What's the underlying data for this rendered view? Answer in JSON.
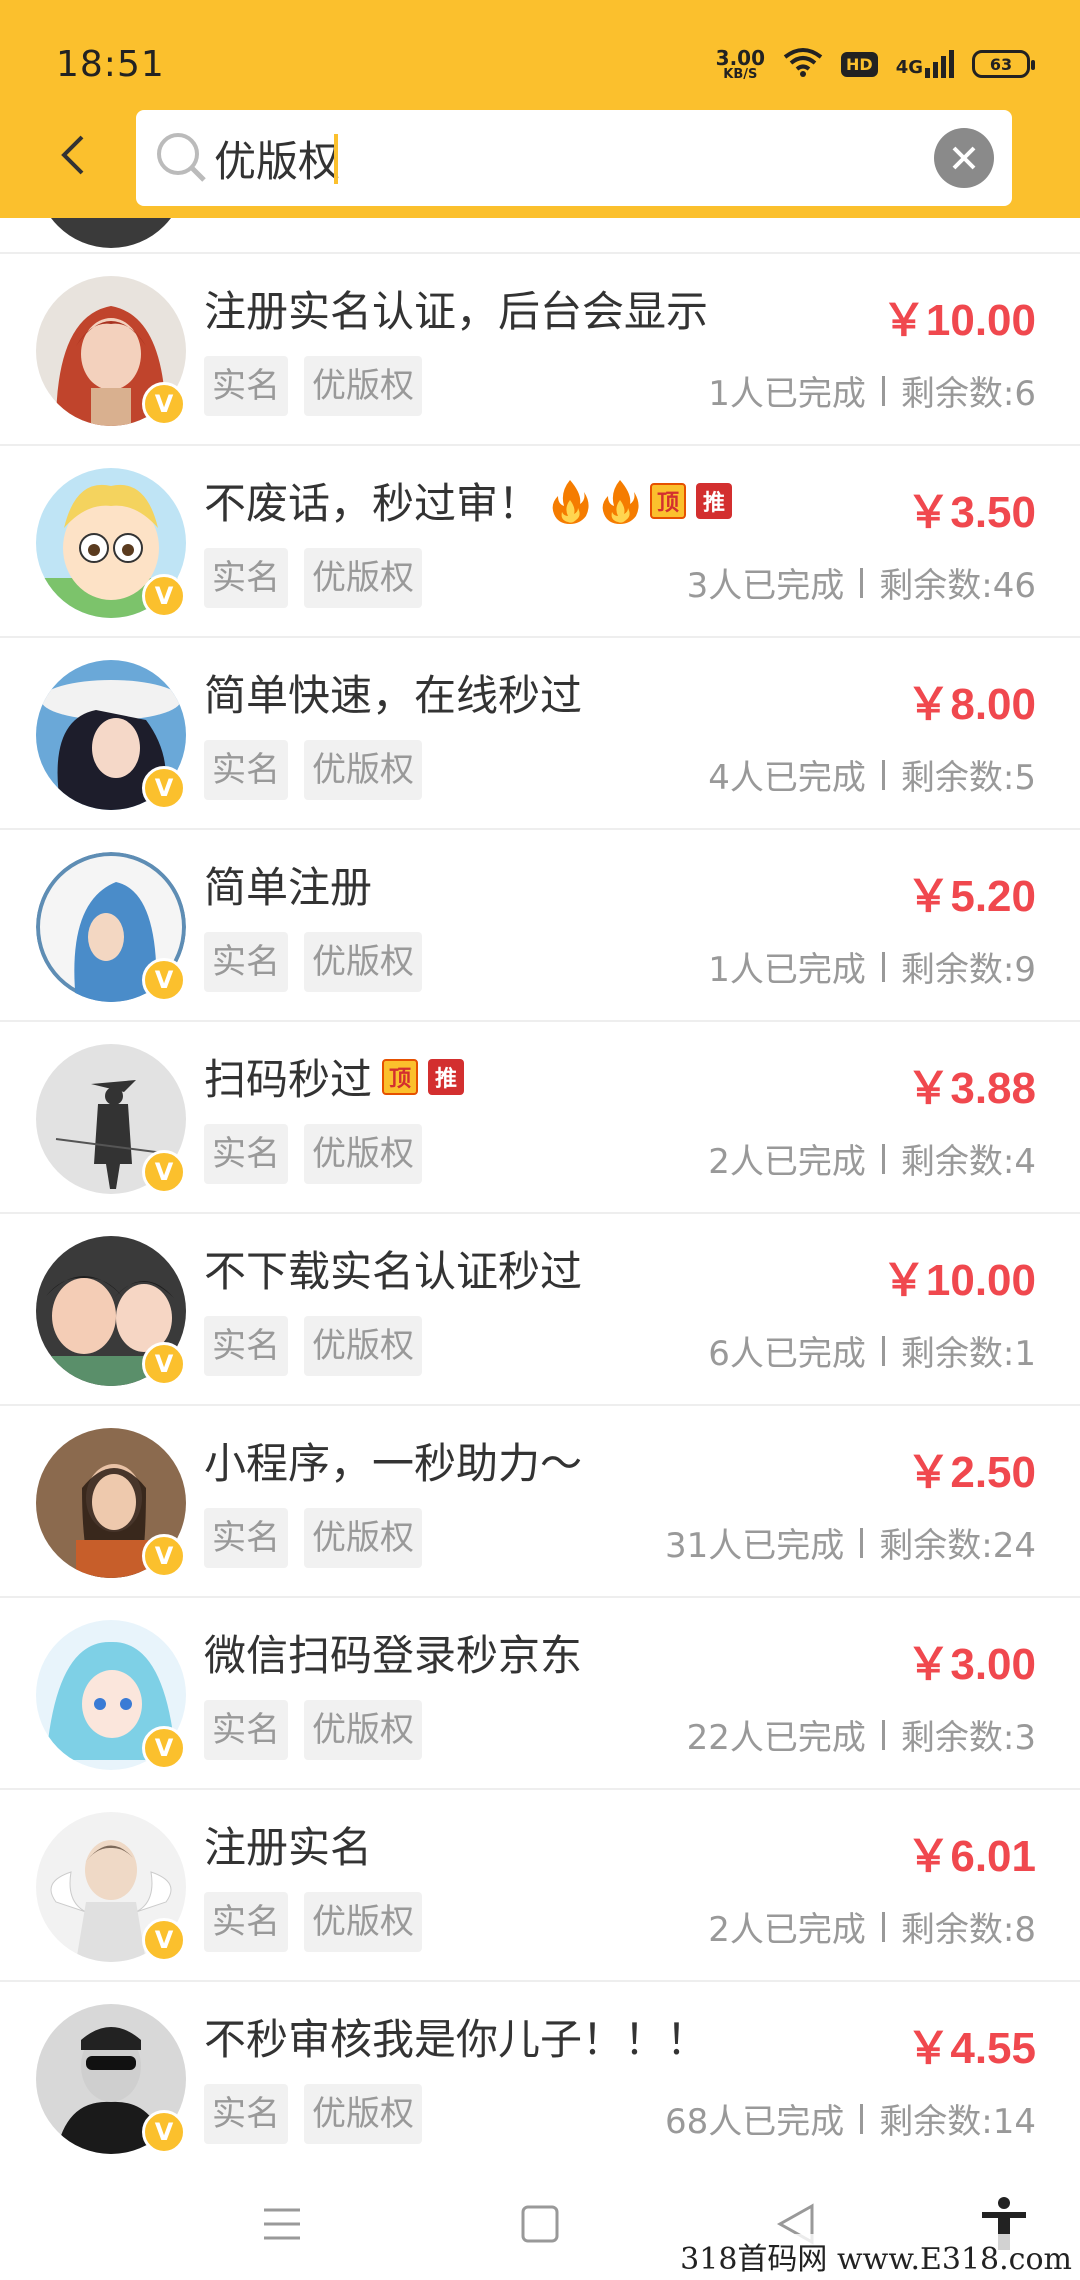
{
  "status_bar": {
    "time": "18:51",
    "net_speed_value": "3.00",
    "net_speed_unit": "KB/S",
    "hd_label": "HD",
    "network_label": "4G",
    "battery": "63"
  },
  "search": {
    "value": "优版权",
    "icon": "search-icon",
    "clear_icon": "close-icon"
  },
  "colors": {
    "header": "#fbc02d",
    "price": "#f0484e",
    "badge": "#fbc02d"
  },
  "verified_mark": "V",
  "items": [
    {
      "title": "注册实名认证，后台会显示",
      "price": "￥10.00",
      "tags": [
        "实名",
        "优版权"
      ],
      "completed": "1人已完成",
      "remaining": "剩余数:6",
      "fires": 0,
      "ding": "",
      "tui": ""
    },
    {
      "title": "不废话，秒过审！",
      "price": "￥3.50",
      "tags": [
        "实名",
        "优版权"
      ],
      "completed": "3人已完成",
      "remaining": "剩余数:46",
      "fires": 2,
      "ding": "顶",
      "tui": "推"
    },
    {
      "title": "简单快速，在线秒过",
      "price": "￥8.00",
      "tags": [
        "实名",
        "优版权"
      ],
      "completed": "4人已完成",
      "remaining": "剩余数:5",
      "fires": 0,
      "ding": "",
      "tui": ""
    },
    {
      "title": "简单注册",
      "price": "￥5.20",
      "tags": [
        "实名",
        "优版权"
      ],
      "completed": "1人已完成",
      "remaining": "剩余数:9",
      "fires": 0,
      "ding": "",
      "tui": ""
    },
    {
      "title": "扫码秒过",
      "price": "￥3.88",
      "tags": [
        "实名",
        "优版权"
      ],
      "completed": "2人已完成",
      "remaining": "剩余数:4",
      "fires": 0,
      "ding": "顶",
      "tui": "推"
    },
    {
      "title": "不下载实名认证秒过",
      "price": "￥10.00",
      "tags": [
        "实名",
        "优版权"
      ],
      "completed": "6人已完成",
      "remaining": "剩余数:1",
      "fires": 0,
      "ding": "",
      "tui": ""
    },
    {
      "title": "小程序，一秒助力～",
      "price": "￥2.50",
      "tags": [
        "实名",
        "优版权"
      ],
      "completed": "31人已完成",
      "remaining": "剩余数:24",
      "fires": 0,
      "ding": "",
      "tui": ""
    },
    {
      "title": "微信扫码登录秒京东",
      "price": "￥3.00",
      "tags": [
        "实名",
        "优版权"
      ],
      "completed": "22人已完成",
      "remaining": "剩余数:3",
      "fires": 0,
      "ding": "",
      "tui": ""
    },
    {
      "title": "注册实名",
      "price": "￥6.01",
      "tags": [
        "实名",
        "优版权"
      ],
      "completed": "2人已完成",
      "remaining": "剩余数:8",
      "fires": 0,
      "ding": "",
      "tui": ""
    },
    {
      "title": "不秒审核我是你儿子！！！",
      "price": "￥4.55",
      "tags": [
        "实名",
        "优版权"
      ],
      "completed": "68人已完成",
      "remaining": "剩余数:14",
      "fires": 0,
      "ding": "",
      "tui": ""
    }
  ],
  "watermark": "318首码网 www.E318.com"
}
